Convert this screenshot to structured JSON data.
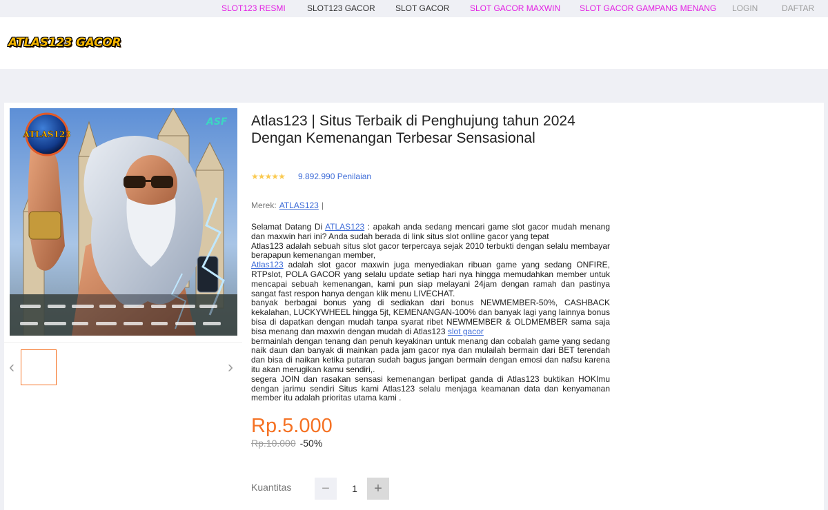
{
  "topnav": {
    "items": [
      {
        "label": "SLOT123 RESMI"
      },
      {
        "label": "SLOT123 GACOR"
      },
      {
        "label": "SLOT GACOR"
      },
      {
        "label": "SLOT GACOR MAXWIN"
      },
      {
        "label": "SLOT GACOR GAMPANG MENANG"
      },
      {
        "label": "LOGIN"
      },
      {
        "label": "DAFTAR"
      }
    ]
  },
  "header": {
    "logo_text": "ATLAS123 GACOR"
  },
  "product": {
    "image_caption": "ATLAS123",
    "image_badge": "ASF",
    "title": "Atlas123 | Situs Terbaik di Penghujung tahun 2024 Dengan Kemenangan Terbesar Sensasional",
    "rating_stars": 5,
    "rating_count": "9.892.990 Penilaian",
    "brand_label": "Merek:",
    "brand_value": "ATLAS123",
    "brand_sep": "|",
    "description": {
      "p1_a": "Selamat Datang Di ",
      "p1_link": "ATLAS123",
      "p1_b": " : apakah anda sedang mencari game slot gacor mudah menang dan maxwin hari ini? Anda sudah berada di link situs slot onlline gacor yang tepat",
      "p2": "Atlas123 adalah sebuah situs slot gacor terpercaya sejak 2010 terbukti dengan selalu membayar berapapun kemenangan member,",
      "p3_link": "Atlas123",
      "p3_b": " adalah slot gacor maxwin juga menyediakan ribuan game yang sedang ONFIRE, RTPslot, POLA GACOR yang selalu update setiap hari nya hingga memudahkan member untuk mencapai sebuah kemenangan, kami pun siap melayani 24jam dengan ramah dan pastinya sangat fast respon hanya dengan klik menu LIVECHAT.",
      "p4_a": "banyak berbagai bonus yang di sediakan dari bonus NEWMEMBER-50%, CASHBACK kekalahan, LUCKYWHEEL hingga 5jt, KEMENANGAN-100% dan banyak lagi yang lainnya bonus bisa di dapatkan dengan mudah tanpa syarat ribet NEWMEMBER & OLDMEMBER sama saja bisa menang dan maxwin dengan mudah di Atlas123 ",
      "p4_link": "slot gacor",
      "p5": "bermainlah dengan tenang dan penuh keyakinan untuk menang dan cobalah game yang sedang naik daun dan banyak di mainkan pada jam gacor nya dan mulailah bermain dari BET terendah dan bisa di naikan ketika putaran sudah bagus jangan bermain dengan emosi dan nafsu karena itu akan merugikan kamu sendiri,.",
      "p6": "segera JOIN dan rasakan sensasi kemenangan berlipat ganda di Atlas123 buktikan HOKImu dengan jarimu sendiri Situs kami Atlas123 selalu menjaga keamanan data dan kenyamanan member itu adalah prioritas utama kami ."
    },
    "price": "Rp.5.000",
    "old_price": "Rp.10.000",
    "discount": "-50%",
    "quantity_label": "Kuantitas",
    "quantity": "1",
    "minus_symbol": "−",
    "plus_symbol": "+",
    "prev_symbol": "‹",
    "next_symbol": "›"
  },
  "colors": {
    "accent_pink": "#e21ee2",
    "price_orange": "#f57224",
    "link_blue": "#3b6ad7",
    "star_yellow": "#faca51"
  }
}
